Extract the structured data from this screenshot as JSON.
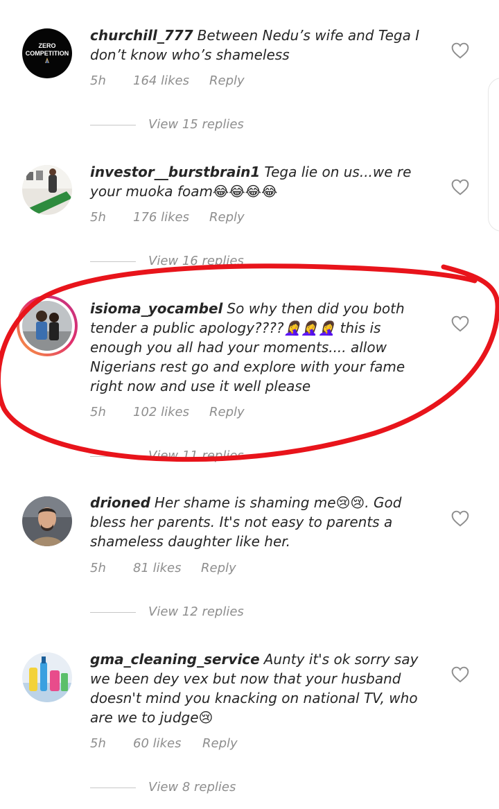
{
  "comments": [
    {
      "username": "churchill_777",
      "text": "Between Nedu’s wife and Tega I don’t know who’s shameless",
      "time": "5h",
      "likes": "164 likes",
      "reply": "Reply",
      "view_replies": "View 15 replies",
      "avatar_logo": "ZERO COMPETITION",
      "avatar_icon": "praying-hands-icon"
    },
    {
      "username": "investor__burstbrain1",
      "text": "Tega lie on us...we re your muoka foam😂😂😂😂",
      "time": "5h",
      "likes": "176 likes",
      "reply": "Reply",
      "view_replies": "View 16 replies",
      "avatar_icon": "room-photo-avatar"
    },
    {
      "username": "isioma_yocambel",
      "text": "So why then did you both tender a public apology????🤦‍♀️🤦‍♀️🤦‍♀️ this is enough you all had your moments.... allow Nigerians rest go and explore with your fame right now and use it well please",
      "time": "5h",
      "likes": "102 likes",
      "reply": "Reply",
      "view_replies": "View 11 replies",
      "avatar_icon": "story-ring-avatar"
    },
    {
      "username": "drioned",
      "text": "Her shame is shaming me😢😢. God bless her parents. It's not easy to parents a shameless daughter like her.",
      "time": "5h",
      "likes": "81 likes",
      "reply": "Reply",
      "view_replies": "View 12 replies",
      "avatar_icon": "man-portrait-avatar"
    },
    {
      "username": "gma_cleaning_service",
      "text": "Aunty it's ok sorry say we been dey vex but now that your husband doesn't mind you knacking on national TV, who are we to judge😢",
      "time": "5h",
      "likes": "60 likes",
      "reply": "Reply",
      "view_replies": "View 8 replies",
      "avatar_icon": "cleaning-supplies-avatar"
    }
  ],
  "icons": {
    "like": "heart-outline-icon"
  },
  "colors": {
    "annotation": "#e8141b",
    "meta_text": "#8e8e8e",
    "story_ring_start": "#f9a03f",
    "story_ring_end": "#c13584"
  }
}
